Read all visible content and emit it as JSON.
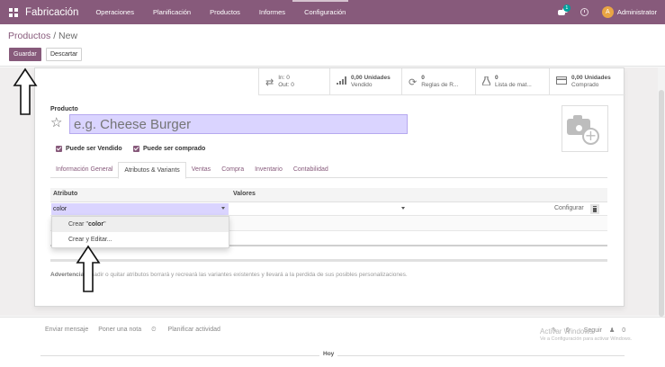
{
  "app": {
    "brand": "Fabricación",
    "menu": [
      "Operaciones",
      "Planificación",
      "Productos",
      "Informes",
      "Configuración"
    ],
    "notification_count": "1",
    "user_initial": "A",
    "user_name": "Administrator"
  },
  "breadcrumb": {
    "parent": "Productos",
    "separator": " / ",
    "current": "New"
  },
  "actions": {
    "save": "Guardar",
    "discard": "Descartar"
  },
  "smart_buttons": [
    {
      "icon": "exchange-icon",
      "line1": "In:  0",
      "line2": "Out:  0"
    },
    {
      "icon": "bar-chart-icon",
      "line1": "0,00 Unidades",
      "line2": "Vendido"
    },
    {
      "icon": "refresh-icon",
      "line1": "0",
      "line2": "Reglas de R..."
    },
    {
      "icon": "flask-icon",
      "line1": "0",
      "line2": "Lista de mat..."
    },
    {
      "icon": "credit-card-icon",
      "line1": "0,00 Unidades",
      "line2": "Comprado"
    }
  ],
  "form": {
    "product_label": "Producto",
    "name_placeholder": "e.g. Cheese Burger",
    "checkbox_sold": "Puede ser Vendido",
    "checkbox_purchased": "Puede ser comprado"
  },
  "tabs": [
    {
      "label": "Información General",
      "active": false
    },
    {
      "label": "Atributos & Variants",
      "active": true
    },
    {
      "label": "Ventas",
      "active": false
    },
    {
      "label": "Compra",
      "active": false
    },
    {
      "label": "Inventario",
      "active": false
    },
    {
      "label": "Contabilidad",
      "active": false
    }
  ],
  "attributes_table": {
    "col_attribute": "Atributo",
    "col_values": "Valores",
    "row_attribute_value": "color",
    "configure_label": "Configurar"
  },
  "dropdown": {
    "create_prefix": "Crear \"",
    "create_term": "color",
    "create_suffix": "\"",
    "create_and_edit": "Crear y Editar..."
  },
  "warning": {
    "bold": "Advertencia:",
    "text": " añadir o quitar atributos borrará y recreará las variantes existentes y llevará a la perdida de sus posibles personalizaciones."
  },
  "chatter": {
    "send_message": "Enviar mensaje",
    "log_note": "Poner una nota",
    "schedule_activity": "Planificar actividad",
    "attachments": "0",
    "follow": "Seguir",
    "followers": "0",
    "today": "Hoy"
  },
  "windows_watermark": {
    "line1": "Activar Windows",
    "line2": "Ve a Configuración para activar Windows."
  },
  "colors": {
    "brand_purple": "#875a7b",
    "input_highlight": "#dad4ff",
    "avatar_orange": "#e9a544",
    "badge_teal": "#00a09d"
  }
}
